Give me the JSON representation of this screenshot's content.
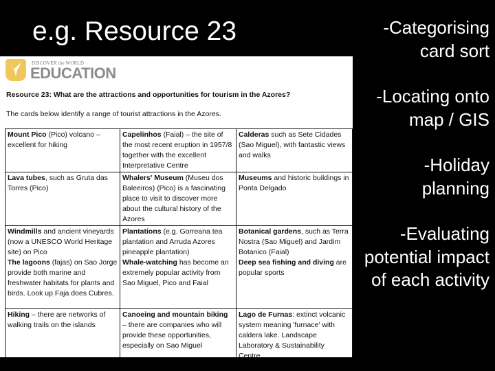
{
  "slide": {
    "title": "e.g. Resource 23",
    "bullets": [
      "-Categorising card sort",
      "-Locating onto map / GIS",
      "-Holiday planning",
      "-Evaluating potential impact of each activity"
    ]
  },
  "document": {
    "logo": {
      "small_text": "DISCOVER the WORLD",
      "big_text": "EDUCATION",
      "icon": "bird-icon",
      "color": "#f0c75a"
    },
    "heading": "Resource 23: What are the attractions and opportunities for tourism in the Azores?",
    "intro": "The cards below identify a range of tourist attractions in the Azores.",
    "cards": [
      [
        {
          "bold": "Mount Pico",
          "text": " (Pico) volcano – excellent for hiking"
        },
        {
          "bold": "Capelinhos",
          "text": " (Faial) – the site of the most recent eruption in 1957/8 together with the excellent Interpretative Centre"
        },
        {
          "bold": "Calderas",
          "text": " such as Sete Cidades (Sao Miguel), with fantastic views and walks"
        }
      ],
      [
        {
          "bold": "Lava tubes",
          "text": ", such as Gruta das Torres (Pico)"
        },
        {
          "bold": "Whalers' Museum",
          "text": " (Museu dos Baleeiros) (Pico) is a fascinating place to visit to discover more about the cultural history of the Azores"
        },
        {
          "bold": "Museums",
          "text": " and historic buildings in Ponta Delgado"
        }
      ],
      [
        {
          "bold": "Windmills",
          "text": " and ancient vineyards (now a UNESCO World Heritage site) on Pico",
          "bold2": "The lagoons",
          "text2": " (fajas) on Sao Jorge provide both marine and freshwater habitats for plants and birds. Look up Faja does Cubres."
        },
        {
          "bold": "Plantations",
          "text": " (e.g. Gorreana tea plantation and Arruda Azores pineapple plantation)",
          "bold2": "Whale-watching",
          "text2": " has become an extremely popular activity from Sao Miguel, Pico and Faial"
        },
        {
          "bold": "Botanical gardens",
          "text": ", such as Terra Nostra (Sao Miguel) and Jardim Botanico (Faial)",
          "bold2": "Deep sea fishing and diving",
          "text2": " are popular sports"
        }
      ],
      [
        {
          "bold": "Hiking",
          "text": " – there are networks of walking trails on the islands"
        },
        {
          "bold": "Canoeing and mountain biking",
          "text": " – there are companies who will provide these opportunities, especially on Sao Miguel"
        },
        {
          "bold": "Lago de Furnas",
          "text": ": extinct volcanic system meaning 'furnace' with caldera lake. Landscape Laboratory & Sustainability Centre."
        }
      ]
    ]
  }
}
